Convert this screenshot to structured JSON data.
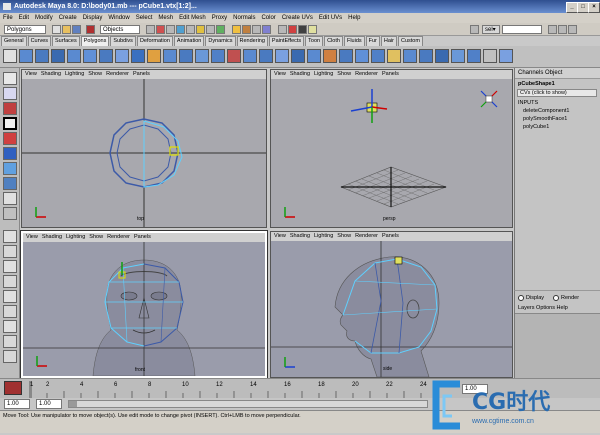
{
  "window": {
    "title": "Autodesk Maya 8.0: D:\\body01.mb  ---  pCube1.vtx[1:2]...",
    "controls": [
      "_",
      "□",
      "×"
    ]
  },
  "menubar": [
    "File",
    "Edit",
    "Modify",
    "Create",
    "Display",
    "Window",
    "Select",
    "Mesh",
    "Edit Mesh",
    "Proxy",
    "Normals",
    "Color",
    "Create UVs",
    "Edit UVs",
    "Help"
  ],
  "statusline": {
    "mode_select": "Polygons",
    "objects_label": "Objects",
    "sel_label": "sel▾"
  },
  "shelf_tabs": [
    "General",
    "Curves",
    "Surfaces",
    "Polygons",
    "Subdivs",
    "Deformation",
    "Animation",
    "Dynamics",
    "Rendering",
    "PaintEffects",
    "Toon",
    "Cloth",
    "Fluids",
    "Fur",
    "Hair",
    "Custom"
  ],
  "shelf_active": "Polygons",
  "viewport_menu": [
    "View",
    "Shading",
    "Lighting",
    "Show",
    "Renderer",
    "Panels"
  ],
  "viewports": {
    "top": {
      "label": "top"
    },
    "persp": {
      "label": "persp"
    },
    "front": {
      "label": "front"
    },
    "side": {
      "label": "side"
    }
  },
  "channel_box": {
    "tabs": "Channels  Object",
    "object_name": "pCubeShape1",
    "cvs_row": "CVs (click to show)",
    "inputs_label": "INPUTS",
    "inputs": [
      "deleteComponent1",
      "polySmoothFace1",
      "polyCube1"
    ]
  },
  "layer_editor": {
    "display_label": "Display",
    "render_label": "Render",
    "menu": "Layers  Options  Help"
  },
  "time_slider": {
    "ticks": [
      "1",
      "2",
      "4",
      "6",
      "8",
      "10",
      "12",
      "14",
      "16",
      "18",
      "20",
      "22",
      "24"
    ],
    "current_frame": "1.00"
  },
  "range_slider": {
    "start": "1.00",
    "end": "1.00"
  },
  "help_line": "Move Tool: Use manipulator to move object(s). Use edit mode to change pivot (INSERT). Ctrl+LMB to move perpendicular.",
  "watermark": {
    "brand": "CG时代",
    "url": "www.cgtime.com.cn"
  },
  "colors": {
    "title_bar": "#2f4f8f",
    "viewport_bg": "#a8a8ae",
    "wire_blue": "#3c5aa8",
    "wire_cyan": "#5fd0ff",
    "axis_red": "#d00000",
    "axis_green": "#10a010",
    "axis_blue": "#1a40d0"
  }
}
